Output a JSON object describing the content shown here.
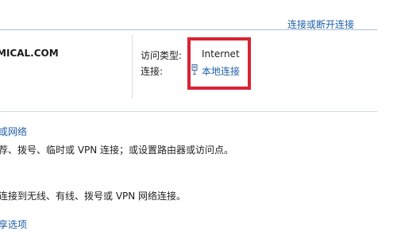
{
  "header": {
    "connect_disconnect_link": "连接或断开连接"
  },
  "active_network": {
    "name": "MICAL.COM",
    "access_type_label": "访问类型:",
    "access_type_value": "Internet",
    "connection_label": "连接:",
    "connection_value": "本地连接",
    "connection_icon": "network-adapter-icon"
  },
  "change_settings": {
    "setup_link": "或网络",
    "setup_desc": "荐、拨号、临时或 VPN 连接；或设置路由器或访问点。",
    "connect_desc": "连接到无线、有线、拨号或 VPN 网络连接。",
    "sharing_link": "享选项"
  },
  "colors": {
    "link": "#1e5fa8",
    "highlight": "#d92332",
    "rule": "#a9c0d8"
  }
}
